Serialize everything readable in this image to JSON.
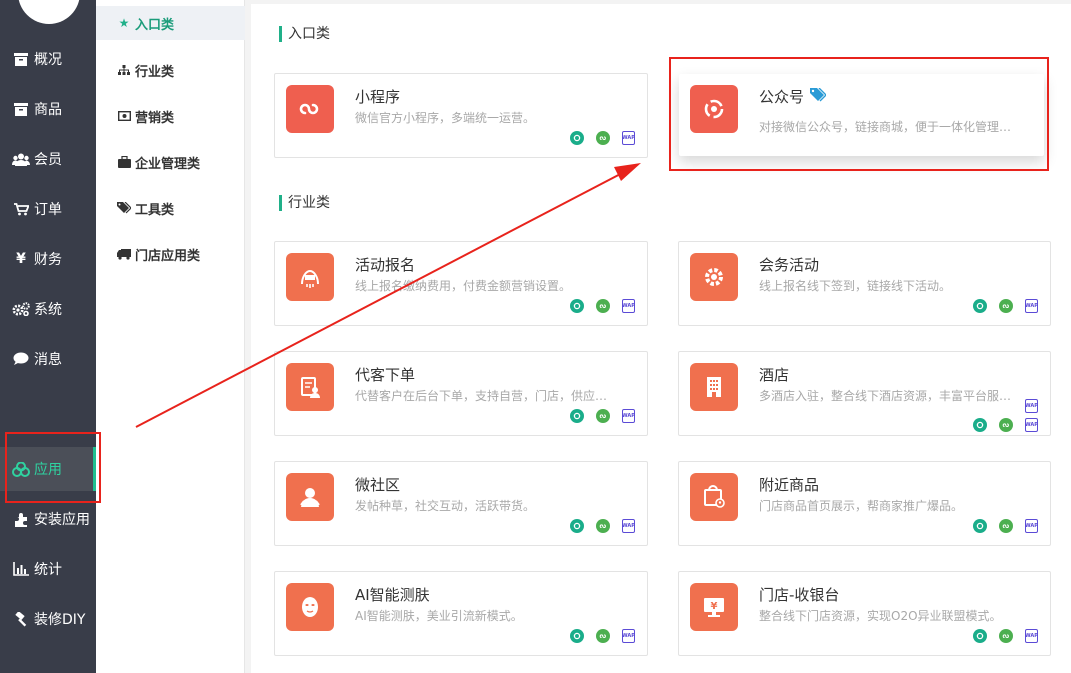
{
  "sidebar": {
    "items": [
      {
        "label": "概况",
        "icon": "box-icon"
      },
      {
        "label": "商品",
        "icon": "box-icon"
      },
      {
        "label": "会员",
        "icon": "users-icon"
      },
      {
        "label": "订单",
        "icon": "cart-icon"
      },
      {
        "label": "财务",
        "icon": "yen-icon"
      },
      {
        "label": "系统",
        "icon": "gears-icon"
      },
      {
        "label": "消息",
        "icon": "chat-icon"
      },
      {
        "label": "应用",
        "icon": "apps-icon"
      },
      {
        "label": "安装应用",
        "icon": "puzzle-icon"
      },
      {
        "label": "统计",
        "icon": "bar-chart-icon"
      },
      {
        "label": "装修DIY",
        "icon": "hammer-icon"
      }
    ],
    "active": "应用"
  },
  "subnav": {
    "items": [
      {
        "label": "入口类",
        "icon": "star-icon"
      },
      {
        "label": "行业类",
        "icon": "sitemap-icon"
      },
      {
        "label": "营销类",
        "icon": "money-icon"
      },
      {
        "label": "企业管理类",
        "icon": "briefcase-icon"
      },
      {
        "label": "工具类",
        "icon": "tags-icon"
      },
      {
        "label": "门店应用类",
        "icon": "truck-icon"
      }
    ],
    "active": "入口类"
  },
  "sections": {
    "entry": {
      "title": "入口类",
      "cards": [
        {
          "name": "小程序",
          "desc": "微信官方小程序，多端统一运营。"
        },
        {
          "name": "公众号",
          "desc": "对接微信公众号，链接商城，便于一体化管理…"
        }
      ]
    },
    "industry": {
      "title": "行业类",
      "cards": [
        {
          "name": "活动报名",
          "desc": "线上报名缴纳费用，付费金额营销设置。"
        },
        {
          "name": "会务活动",
          "desc": "线上报名线下签到，链接线下活动。"
        },
        {
          "name": "代客下单",
          "desc": "代替客户在后台下单，支持自营，门店，供应…"
        },
        {
          "name": "酒店",
          "desc": "多酒店入驻，整合线下酒店资源，丰富平台服…"
        },
        {
          "name": "微社区",
          "desc": "发帖种草，社交互动，活跃带货。"
        },
        {
          "name": "附近商品",
          "desc": "门店商品首页展示，帮商家推广爆品。"
        },
        {
          "name": "AI智能测肤",
          "desc": "AI智能测肤，美业引流新模式。"
        },
        {
          "name": "门店-收银台",
          "desc": "整合线下门店资源，实现O2O异业联盟模式。"
        }
      ]
    }
  },
  "badge_text": {
    "wap": "WAP"
  },
  "colors": {
    "accent": "#20b089",
    "sidebar_bg": "#393d49",
    "icon_red": "#ef5f4f",
    "icon_orange": "#f0704e",
    "annotation": "#e8231c"
  }
}
